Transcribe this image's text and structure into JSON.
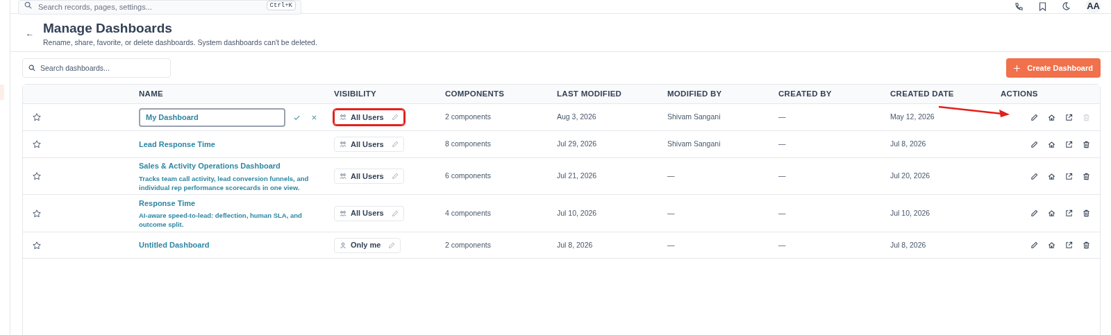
{
  "topbar": {
    "search": {
      "placeholder": "Search records, pages, settings...",
      "shortcut": "Ctrl+K"
    },
    "avatar": "AA"
  },
  "header": {
    "back": "←",
    "title": "Manage Dashboards",
    "subtitle": "Rename, share, favorite, or delete dashboards. System dashboards can't be deleted."
  },
  "search": {
    "placeholder": "Search dashboards..."
  },
  "create_button": "Create Dashboard",
  "table": {
    "columns": [
      "NAME",
      "VISIBILITY",
      "COMPONENTS",
      "LAST MODIFIED",
      "MODIFIED BY",
      "CREATED BY",
      "CREATED DATE",
      "ACTIONS"
    ],
    "rows": [
      {
        "favorite": false,
        "editing": true,
        "name": "My Dashboard",
        "visibility": {
          "kind": "all",
          "label": "All Users"
        },
        "components": "2 components",
        "last_modified": "Aug 3, 2026",
        "modified_by": "Shivam Sangani",
        "created_by": "—",
        "created_date": "May 12, 2026",
        "delete_disabled": true,
        "visibility_highlighted": true,
        "edit_arrow": true
      },
      {
        "favorite": false,
        "editing": false,
        "name": "Lead Response Time",
        "visibility": {
          "kind": "all",
          "label": "All Users"
        },
        "components": "8 components",
        "last_modified": "Jul 29, 2026",
        "modified_by": "Shivam Sangani",
        "created_by": "—",
        "created_date": "Jul 8, 2026",
        "delete_disabled": false,
        "visibility_highlighted": false,
        "edit_arrow": false
      },
      {
        "favorite": false,
        "editing": false,
        "name": "Sales & Activity Operations Dashboard",
        "description": "Tracks team call activity, lead conversion funnels, and individual rep performance scorecards in one view.",
        "visibility": {
          "kind": "all",
          "label": "All Users"
        },
        "components": "6 components",
        "last_modified": "Jul 21, 2026",
        "modified_by": "—",
        "created_by": "—",
        "created_date": "Jul 20, 2026",
        "delete_disabled": false,
        "visibility_highlighted": false,
        "edit_arrow": false
      },
      {
        "favorite": false,
        "editing": false,
        "name": "Response Time",
        "description": "AI-aware speed-to-lead: deflection, human SLA, and outcome split.",
        "visibility": {
          "kind": "all",
          "label": "All Users"
        },
        "components": "4 components",
        "last_modified": "Jul 10, 2026",
        "modified_by": "—",
        "created_by": "—",
        "created_date": "Jul 10, 2026",
        "delete_disabled": false,
        "visibility_highlighted": false,
        "edit_arrow": false
      },
      {
        "favorite": false,
        "editing": false,
        "name": "Untitled Dashboard",
        "visibility": {
          "kind": "private",
          "label": "Only me"
        },
        "components": "2 components",
        "last_modified": "Jul 8, 2026",
        "modified_by": "—",
        "created_by": "—",
        "created_date": "Jul 8, 2026",
        "delete_disabled": false,
        "visibility_highlighted": false,
        "edit_arrow": false
      }
    ]
  }
}
